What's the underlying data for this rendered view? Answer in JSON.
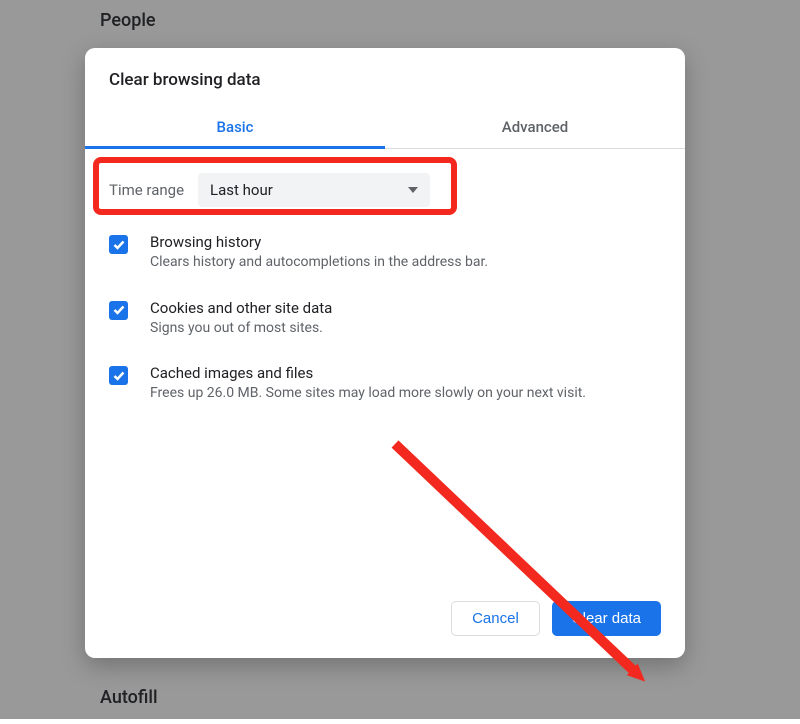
{
  "background": {
    "people_label": "People",
    "autofill_label": "Autofill"
  },
  "dialog": {
    "title": "Clear browsing data",
    "tabs": {
      "basic": "Basic",
      "advanced": "Advanced"
    },
    "time_range": {
      "label": "Time range",
      "value": "Last hour"
    },
    "options": [
      {
        "title": "Browsing history",
        "desc": "Clears history and autocompletions in the address bar."
      },
      {
        "title": "Cookies and other site data",
        "desc": "Signs you out of most sites."
      },
      {
        "title": "Cached images and files",
        "desc": "Frees up 26.0 MB. Some sites may load more slowly on your next visit."
      }
    ],
    "buttons": {
      "cancel": "Cancel",
      "clear": "Clear data"
    }
  }
}
